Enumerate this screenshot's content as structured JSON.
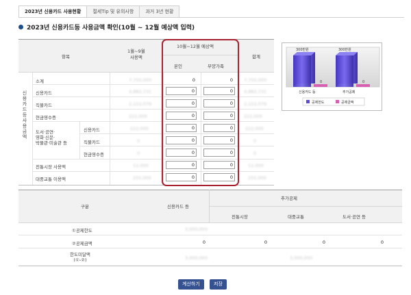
{
  "tabs": [
    {
      "label": "2023년 신용카드 사용현황",
      "active": true
    },
    {
      "label": "절세Tip 및 유의사항",
      "active": false
    },
    {
      "label": "과거 3년 현황",
      "active": false
    }
  ],
  "title": "2023년 신용카드등 사용금액 확인(10월 ~ 12월 예상액 입력)",
  "top_table": {
    "headers": {
      "item": "항목",
      "jan_sep": "1월~9월\n사용액",
      "oct_dec": "10월~12월 예상액",
      "self": "본인",
      "dependent": "부양가족",
      "total": "합계"
    },
    "vertical_label": "신용카드등 사용금액",
    "rows": [
      {
        "label": "소계",
        "jan_sep": "7,750,000",
        "self": "0",
        "dep": "0",
        "total": "7,750,000",
        "inputs": false
      },
      {
        "label": "신용카드",
        "jan_sep": "4,882,731",
        "self": "0",
        "dep": "0",
        "total": "4,882,731",
        "inputs": true
      },
      {
        "label": "직불카드",
        "jan_sep": "2,222,079",
        "self": "0",
        "dep": "0",
        "total": "2,222,079",
        "inputs": true
      },
      {
        "label": "현금영수증",
        "jan_sep": "222,000",
        "self": "0",
        "dep": "0",
        "total": "222,000",
        "inputs": true
      },
      {
        "label": "신용카드",
        "jan_sep": "222,000",
        "self": "0",
        "dep": "0",
        "total": "222,000",
        "inputs": true
      },
      {
        "label": "직불카드",
        "jan_sep": "0",
        "self": "0",
        "dep": "0",
        "total": "0",
        "inputs": true
      },
      {
        "label": "현금영수증",
        "jan_sep": "0",
        "self": "0",
        "dep": "0",
        "total": "0",
        "inputs": true
      },
      {
        "label": "전통시장 사용액",
        "jan_sep": "12,000",
        "self": "0",
        "dep": "0",
        "total": "12,000",
        "inputs": true
      },
      {
        "label": "대중교통 이용액",
        "jan_sep": "255,000",
        "self": "0",
        "dep": "0",
        "total": "255,000",
        "inputs": true
      }
    ],
    "group_label": "도서·공연·\n영화·신문·\n박물관·미술관 등"
  },
  "chart": {
    "bar1_label": "300만원",
    "bar2_label": "300만원",
    "zero1": "0",
    "zero2": "0",
    "cat1": "신용카드 등",
    "cat2": "추가공제",
    "legend1": "공제한도",
    "legend2": "공제금액",
    "color1": "#5b4bd8",
    "color2": "#d75fb0"
  },
  "bottom_table": {
    "h_gubun": "구분",
    "h_card": "신용카드 등",
    "h_extra": "추가공제",
    "h_market": "전통시장",
    "h_transit": "대중교통",
    "h_culture": "도서·공연 등",
    "rows": [
      {
        "label": "①공제한도",
        "card": "3,000,000",
        "market": "",
        "transit": "",
        "culture": ""
      },
      {
        "label": "②공제금액",
        "card": "0",
        "market": "0",
        "transit": "0",
        "culture": "0"
      },
      {
        "label": "한도미달액\n(①-②)",
        "card": "3,000,000",
        "market": "",
        "transit": "3,000,000",
        "culture": ""
      }
    ]
  },
  "buttons": {
    "calc": "계산하기",
    "save": "저장"
  }
}
